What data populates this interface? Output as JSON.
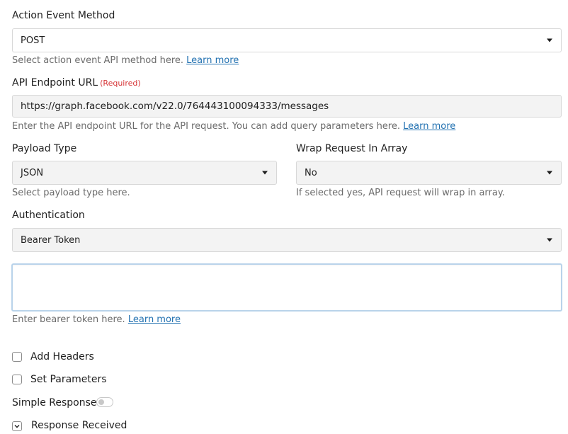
{
  "action_event_method": {
    "label": "Action Event Method",
    "value": "POST",
    "help": "Select action event API method here.",
    "help_link": "Learn more"
  },
  "api_endpoint": {
    "label": "API Endpoint URL",
    "required": "(Required)",
    "value": "https://graph.facebook.com/v22.0/764443100094333/messages",
    "help": "Enter the API endpoint URL for the API request. You can add query parameters here.",
    "help_link": "Learn more"
  },
  "payload_type": {
    "label": "Payload Type",
    "value": "JSON",
    "help": "Select payload type here."
  },
  "wrap_request": {
    "label": "Wrap Request In Array",
    "value": "No",
    "help": "If selected yes, API request will wrap in array."
  },
  "authentication": {
    "label": "Authentication",
    "value": "Bearer Token"
  },
  "bearer_token": {
    "value": "",
    "help": "Enter bearer token here.",
    "help_link": "Learn more"
  },
  "add_headers": {
    "label": "Add Headers",
    "checked": false
  },
  "set_parameters": {
    "label": "Set Parameters",
    "checked": false
  },
  "simple_response": {
    "label": "Simple Response",
    "enabled": false
  },
  "response_received": {
    "label": "Response Received"
  }
}
